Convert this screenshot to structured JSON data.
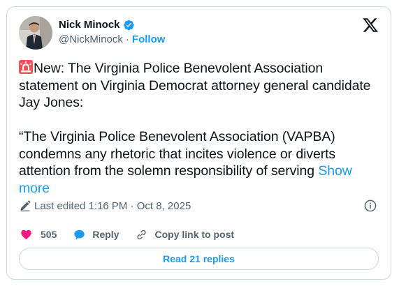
{
  "author": {
    "display_name": "Nick Minock",
    "handle": "@NickMinock",
    "separator": "·",
    "follow_label": "Follow",
    "verified_color": "#1d9bf0"
  },
  "platform_icon": "x-logo-icon",
  "tweet": {
    "line_intro": "New: The Virginia Police Benevolent Association statement on Virginia Democrat attorney general candidate Jay Jones:",
    "line_quote": "“The Virginia Police Benevolent Association (VAPBA) condemns any rhetoric that incites violence or diverts attention from the solemn responsibility of serving",
    "show_more": "Show more",
    "emoji_icon": "police-siren-icon"
  },
  "meta": {
    "edited_label": "Last edited 1:16 PM · Oct 8, 2025",
    "info_icon": "info-icon"
  },
  "actions": {
    "like_count": "505",
    "like_color": "#f91880",
    "reply_label": "Reply",
    "reply_color": "#1d9bf0",
    "copy_label": "Copy link to post"
  },
  "footer": {
    "read_replies_label": "Read 21 replies"
  },
  "colors": {
    "accent": "#1d9bf0",
    "text_primary": "#0f1419",
    "text_secondary": "#536471",
    "border": "#cfd9de"
  }
}
